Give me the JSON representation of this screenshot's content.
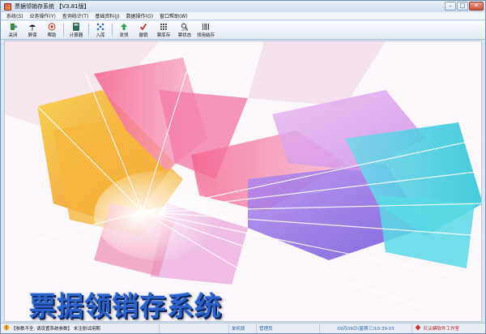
{
  "window": {
    "title": "票据领销存系统 【V3.81版】"
  },
  "window_controls": {
    "minimize": "–",
    "maximize": "□",
    "close": "✕"
  },
  "menu": [
    "系统(S)",
    "业务操作(Y)",
    "查询统计(T)",
    "基础资料(J)",
    "数据操作(O)",
    "窗口帮助(W)"
  ],
  "toolbar": [
    {
      "label": "关闭",
      "icon": "exit-door-icon",
      "color": "#3a8a3a"
    },
    {
      "label": "屏保",
      "icon": "umbrella-icon",
      "color": "#222222"
    },
    {
      "label": "帮助",
      "icon": "help-icon",
      "color": "#c23a2a"
    },
    {
      "label": "计算器",
      "icon": "calculator-icon",
      "color": "#2b6b5a"
    },
    {
      "label": "入库",
      "icon": "stock-in-icon",
      "color": "#2b5fb8"
    },
    {
      "label": "发领",
      "icon": "issue-arrow-icon",
      "color": "#2b9a4a"
    },
    {
      "label": "撤销",
      "icon": "undo-check-icon",
      "color": "#c7302a"
    },
    {
      "label": "票库存",
      "icon": "ticket-stock-icon",
      "color": "#555555"
    },
    {
      "label": "票状态",
      "icon": "ticket-status-icon",
      "color": "#444444"
    },
    {
      "label": "领用结存",
      "icon": "balance-barcode-icon",
      "color": "#444444"
    }
  ],
  "banner": {
    "text": "票据领销存系统",
    "color": "#2d63c8"
  },
  "status": {
    "warning": "【参数不全, 请设置系统参数】 未注册试用期",
    "host": "单机版",
    "user": "管理员",
    "clock": "09月09日(星期三)10:39:03",
    "company": "红尖蟒软件工作室"
  }
}
